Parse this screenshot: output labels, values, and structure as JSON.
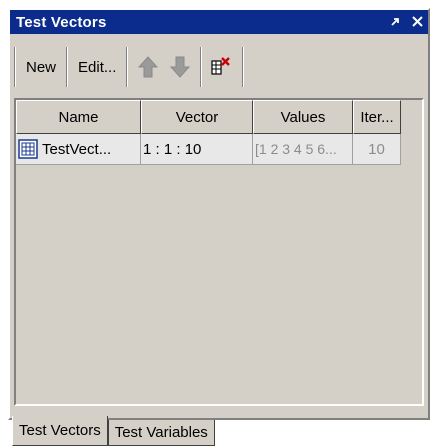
{
  "window": {
    "title": "Test Vectors",
    "pin_glyph": "↗",
    "close_glyph": "✕"
  },
  "toolbar": {
    "new_label": "New",
    "edit_label": "Edit...",
    "move_up_icon": "arrow-up-icon",
    "move_down_icon": "arrow-down-icon",
    "delete_icon": "delete-vector-icon"
  },
  "table": {
    "columns": [
      "Name",
      "Vector",
      "Values",
      "Iter..."
    ],
    "rows": [
      {
        "icon": "test-vector-icon",
        "name": "TestVect...",
        "vector": "1 : 1 : 10",
        "values": "[1 2 3 4 5 6...",
        "iterations": "10"
      }
    ]
  },
  "tabs": [
    {
      "label": "Test Vectors",
      "active": true
    },
    {
      "label": "Test Variables",
      "active": false
    }
  ],
  "colors": {
    "title_bar": "#0b2c8c",
    "panel": "#d4d0c8",
    "arrow_disabled": "#9a9a9a",
    "delete_x": "#cc0000"
  }
}
